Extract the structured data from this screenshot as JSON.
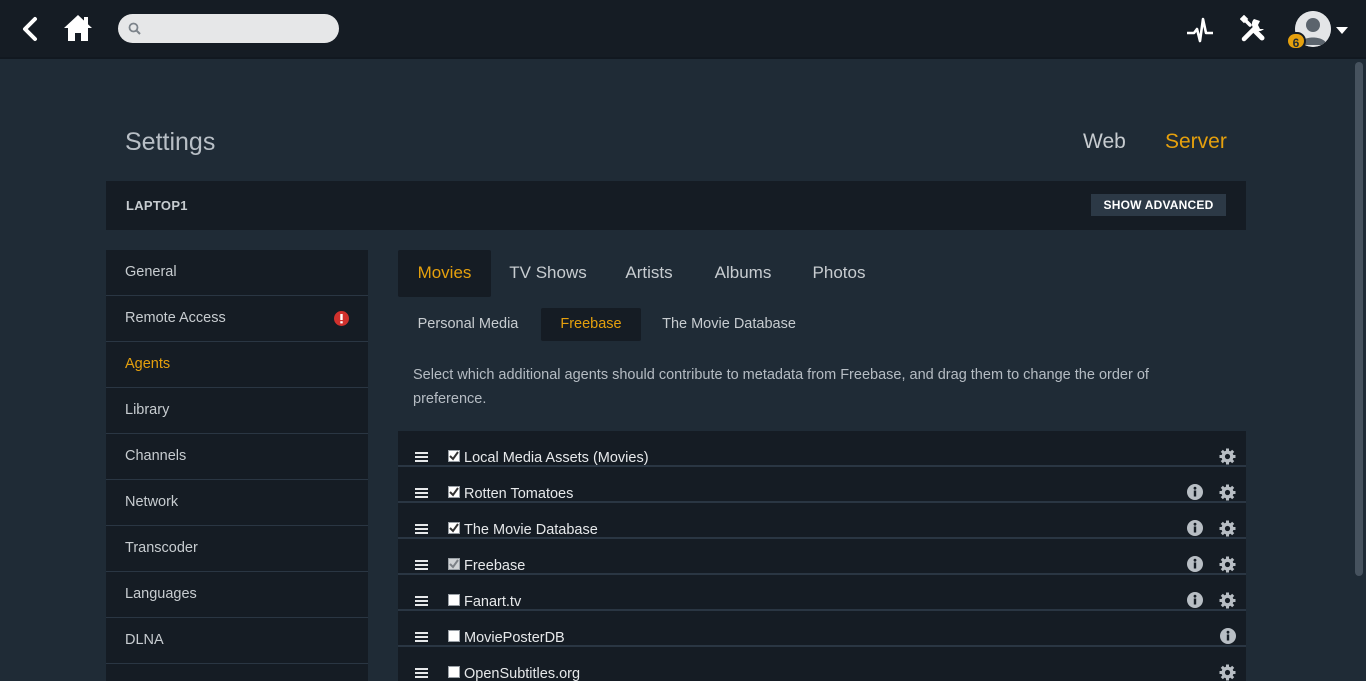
{
  "header": {
    "search": {
      "value": "",
      "placeholder": ""
    },
    "badge_count": "6",
    "icons": [
      "back-arrow-icon",
      "home-icon",
      "search-icon",
      "activity-icon",
      "tools-icon",
      "user-icon",
      "caret-down-icon"
    ]
  },
  "page": {
    "title": "Settings",
    "tabs": [
      {
        "label": "Web",
        "active": false
      },
      {
        "label": "Server",
        "active": true
      }
    ]
  },
  "server": {
    "name": "LAPTOP1",
    "advanced_button": "SHOW ADVANCED"
  },
  "sidebar": {
    "items": [
      {
        "label": "General",
        "active": false
      },
      {
        "label": "Remote Access",
        "active": false,
        "alert": true
      },
      {
        "label": "Agents",
        "active": true
      },
      {
        "label": "Library",
        "active": false
      },
      {
        "label": "Channels",
        "active": false
      },
      {
        "label": "Network",
        "active": false
      },
      {
        "label": "Transcoder",
        "active": false
      },
      {
        "label": "Languages",
        "active": false
      },
      {
        "label": "DLNA",
        "active": false
      }
    ]
  },
  "media_tabs": [
    {
      "label": "Movies",
      "active": true
    },
    {
      "label": "TV Shows",
      "active": false
    },
    {
      "label": "Artists",
      "active": false
    },
    {
      "label": "Albums",
      "active": false
    },
    {
      "label": "Photos",
      "active": false
    }
  ],
  "source_tabs": [
    {
      "label": "Personal Media",
      "active": false
    },
    {
      "label": "Freebase",
      "active": true
    },
    {
      "label": "The Movie Database",
      "active": false
    }
  ],
  "description": "Select which additional agents should contribute to metadata from Freebase, and drag them to change the order of preference.",
  "agents": [
    {
      "label": "Local Media Assets (Movies)",
      "checked": true,
      "disabled": false,
      "info": false,
      "settings": true
    },
    {
      "label": "Rotten Tomatoes",
      "checked": true,
      "disabled": false,
      "info": true,
      "settings": true
    },
    {
      "label": "The Movie Database",
      "checked": true,
      "disabled": false,
      "info": true,
      "settings": true
    },
    {
      "label": "Freebase",
      "checked": true,
      "disabled": true,
      "info": true,
      "settings": true
    },
    {
      "label": "Fanart.tv",
      "checked": false,
      "disabled": false,
      "info": true,
      "settings": true
    },
    {
      "label": "MoviePosterDB",
      "checked": false,
      "disabled": false,
      "info": true,
      "settings": false
    },
    {
      "label": "OpenSubtitles.org",
      "checked": false,
      "disabled": false,
      "info": false,
      "settings": true
    }
  ],
  "colors": {
    "accent": "#e5a00d",
    "background": "#1f2b36",
    "panel": "#151c24"
  }
}
